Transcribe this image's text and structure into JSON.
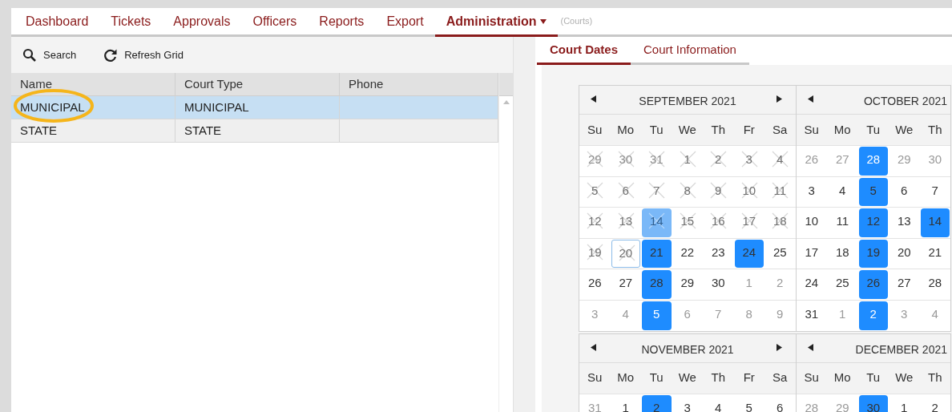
{
  "nav": {
    "tabs": [
      {
        "label": "Dashboard",
        "selected": false,
        "menu": false
      },
      {
        "label": "Tickets",
        "selected": false,
        "menu": false
      },
      {
        "label": "Approvals",
        "selected": false,
        "menu": false
      },
      {
        "label": "Officers",
        "selected": false,
        "menu": false
      },
      {
        "label": "Reports",
        "selected": false,
        "menu": false
      },
      {
        "label": "Export",
        "selected": false,
        "menu": false
      },
      {
        "label": "Administration",
        "selected": true,
        "menu": true
      }
    ],
    "context": "(Courts)"
  },
  "toolbar": [
    {
      "kind": "search",
      "label": "Search"
    },
    {
      "kind": "refresh",
      "label": "Refresh Grid"
    }
  ],
  "grid": {
    "columns": [
      "Name",
      "Court Type",
      "Phone"
    ],
    "rows": [
      {
        "cells": [
          "MUNICIPAL",
          "MUNICIPAL",
          ""
        ],
        "selected": true,
        "circled": true
      },
      {
        "cells": [
          "STATE",
          "STATE",
          ""
        ],
        "selected": false,
        "circled": false
      }
    ]
  },
  "detail_tabs": [
    {
      "label": "Court Dates",
      "selected": true
    },
    {
      "label": "Court Information",
      "selected": false
    }
  ],
  "calendars": [
    {
      "title": "SEPTEMBER 2021",
      "has_next": true,
      "weekdays": [
        "Su",
        "Mo",
        "Tu",
        "We",
        "Th",
        "Fr",
        "Sa"
      ],
      "weeks": [
        [
          {
            "d": "29",
            "muted": true,
            "crossed": true,
            "marked": false,
            "today": false
          },
          {
            "d": "30",
            "muted": true,
            "crossed": true,
            "marked": false,
            "today": false
          },
          {
            "d": "31",
            "muted": true,
            "crossed": true,
            "marked": false,
            "today": false
          },
          {
            "d": "1",
            "muted": false,
            "crossed": true,
            "marked": false,
            "today": false
          },
          {
            "d": "2",
            "muted": false,
            "crossed": true,
            "marked": false,
            "today": false
          },
          {
            "d": "3",
            "muted": false,
            "crossed": true,
            "marked": false,
            "today": false
          },
          {
            "d": "4",
            "muted": false,
            "crossed": true,
            "marked": false,
            "today": false
          }
        ],
        [
          {
            "d": "5",
            "muted": false,
            "crossed": true,
            "marked": false,
            "today": false
          },
          {
            "d": "6",
            "muted": false,
            "crossed": true,
            "marked": false,
            "today": false
          },
          {
            "d": "7",
            "muted": false,
            "crossed": true,
            "marked": false,
            "today": false
          },
          {
            "d": "8",
            "muted": false,
            "crossed": true,
            "marked": false,
            "today": false
          },
          {
            "d": "9",
            "muted": false,
            "crossed": true,
            "marked": false,
            "today": false
          },
          {
            "d": "10",
            "muted": false,
            "crossed": true,
            "marked": false,
            "today": false
          },
          {
            "d": "11",
            "muted": false,
            "crossed": true,
            "marked": false,
            "today": false
          }
        ],
        [
          {
            "d": "12",
            "muted": false,
            "crossed": true,
            "marked": false,
            "today": false
          },
          {
            "d": "13",
            "muted": false,
            "crossed": true,
            "marked": false,
            "today": false
          },
          {
            "d": "14",
            "muted": false,
            "crossed": true,
            "marked": true,
            "today": false
          },
          {
            "d": "15",
            "muted": false,
            "crossed": true,
            "marked": false,
            "today": false
          },
          {
            "d": "16",
            "muted": false,
            "crossed": true,
            "marked": false,
            "today": false
          },
          {
            "d": "17",
            "muted": false,
            "crossed": true,
            "marked": false,
            "today": false
          },
          {
            "d": "18",
            "muted": false,
            "crossed": true,
            "marked": false,
            "today": false
          }
        ],
        [
          {
            "d": "19",
            "muted": false,
            "crossed": true,
            "marked": false,
            "today": false
          },
          {
            "d": "20",
            "muted": false,
            "crossed": true,
            "marked": false,
            "today": true
          },
          {
            "d": "21",
            "muted": false,
            "crossed": false,
            "marked": true,
            "today": false
          },
          {
            "d": "22",
            "muted": false,
            "crossed": false,
            "marked": false,
            "today": false
          },
          {
            "d": "23",
            "muted": false,
            "crossed": false,
            "marked": false,
            "today": false
          },
          {
            "d": "24",
            "muted": false,
            "crossed": false,
            "marked": true,
            "today": false
          },
          {
            "d": "25",
            "muted": false,
            "crossed": false,
            "marked": false,
            "today": false
          }
        ],
        [
          {
            "d": "26",
            "muted": false,
            "crossed": false,
            "marked": false,
            "today": false
          },
          {
            "d": "27",
            "muted": false,
            "crossed": false,
            "marked": false,
            "today": false
          },
          {
            "d": "28",
            "muted": false,
            "crossed": false,
            "marked": true,
            "today": false
          },
          {
            "d": "29",
            "muted": false,
            "crossed": false,
            "marked": false,
            "today": false
          },
          {
            "d": "30",
            "muted": false,
            "crossed": false,
            "marked": false,
            "today": false
          },
          {
            "d": "1",
            "muted": true,
            "crossed": false,
            "marked": false,
            "today": false
          },
          {
            "d": "2",
            "muted": true,
            "crossed": false,
            "marked": false,
            "today": false
          }
        ],
        [
          {
            "d": "3",
            "muted": true,
            "crossed": false,
            "marked": false,
            "today": false
          },
          {
            "d": "4",
            "muted": true,
            "crossed": false,
            "marked": false,
            "today": false
          },
          {
            "d": "5",
            "muted": true,
            "crossed": false,
            "marked": true,
            "today": false
          },
          {
            "d": "6",
            "muted": true,
            "crossed": false,
            "marked": false,
            "today": false
          },
          {
            "d": "7",
            "muted": true,
            "crossed": false,
            "marked": false,
            "today": false
          },
          {
            "d": "8",
            "muted": true,
            "crossed": false,
            "marked": false,
            "today": false
          },
          {
            "d": "9",
            "muted": true,
            "crossed": false,
            "marked": false,
            "today": false
          }
        ]
      ]
    },
    {
      "title": "OCTOBER 2021",
      "has_next": false,
      "weekdays": [
        "Su",
        "Mo",
        "Tu",
        "We",
        "Th"
      ],
      "weeks": [
        [
          {
            "d": "26",
            "muted": true,
            "crossed": false,
            "marked": false,
            "today": false
          },
          {
            "d": "27",
            "muted": true,
            "crossed": false,
            "marked": false,
            "today": false
          },
          {
            "d": "28",
            "muted": true,
            "crossed": false,
            "marked": true,
            "today": false
          },
          {
            "d": "29",
            "muted": true,
            "crossed": false,
            "marked": false,
            "today": false
          },
          {
            "d": "30",
            "muted": true,
            "crossed": false,
            "marked": false,
            "today": false
          }
        ],
        [
          {
            "d": "3",
            "muted": false,
            "crossed": false,
            "marked": false,
            "today": false
          },
          {
            "d": "4",
            "muted": false,
            "crossed": false,
            "marked": false,
            "today": false
          },
          {
            "d": "5",
            "muted": false,
            "crossed": false,
            "marked": true,
            "today": false
          },
          {
            "d": "6",
            "muted": false,
            "crossed": false,
            "marked": false,
            "today": false
          },
          {
            "d": "7",
            "muted": false,
            "crossed": false,
            "marked": false,
            "today": false
          }
        ],
        [
          {
            "d": "10",
            "muted": false,
            "crossed": false,
            "marked": false,
            "today": false
          },
          {
            "d": "11",
            "muted": false,
            "crossed": false,
            "marked": false,
            "today": false
          },
          {
            "d": "12",
            "muted": false,
            "crossed": false,
            "marked": true,
            "today": false
          },
          {
            "d": "13",
            "muted": false,
            "crossed": false,
            "marked": false,
            "today": false
          },
          {
            "d": "14",
            "muted": false,
            "crossed": false,
            "marked": true,
            "today": false
          }
        ],
        [
          {
            "d": "17",
            "muted": false,
            "crossed": false,
            "marked": false,
            "today": false
          },
          {
            "d": "18",
            "muted": false,
            "crossed": false,
            "marked": false,
            "today": false
          },
          {
            "d": "19",
            "muted": false,
            "crossed": false,
            "marked": true,
            "today": false
          },
          {
            "d": "20",
            "muted": false,
            "crossed": false,
            "marked": false,
            "today": false
          },
          {
            "d": "21",
            "muted": false,
            "crossed": false,
            "marked": false,
            "today": false
          }
        ],
        [
          {
            "d": "24",
            "muted": false,
            "crossed": false,
            "marked": false,
            "today": false
          },
          {
            "d": "25",
            "muted": false,
            "crossed": false,
            "marked": false,
            "today": false
          },
          {
            "d": "26",
            "muted": false,
            "crossed": false,
            "marked": true,
            "today": false
          },
          {
            "d": "27",
            "muted": false,
            "crossed": false,
            "marked": false,
            "today": false
          },
          {
            "d": "28",
            "muted": false,
            "crossed": false,
            "marked": false,
            "today": false
          }
        ],
        [
          {
            "d": "31",
            "muted": false,
            "crossed": false,
            "marked": false,
            "today": false
          },
          {
            "d": "1",
            "muted": true,
            "crossed": false,
            "marked": false,
            "today": false
          },
          {
            "d": "2",
            "muted": true,
            "crossed": false,
            "marked": true,
            "today": false
          },
          {
            "d": "3",
            "muted": true,
            "crossed": false,
            "marked": false,
            "today": false
          },
          {
            "d": "4",
            "muted": true,
            "crossed": false,
            "marked": false,
            "today": false
          }
        ]
      ]
    },
    {
      "title": "NOVEMBER 2021",
      "has_next": true,
      "weekdays": [
        "Su",
        "Mo",
        "Tu",
        "We",
        "Th",
        "Fr",
        "Sa"
      ],
      "weeks": [
        [
          {
            "d": "31",
            "muted": true,
            "crossed": false,
            "marked": false,
            "today": false
          },
          {
            "d": "1",
            "muted": false,
            "crossed": false,
            "marked": false,
            "today": false
          },
          {
            "d": "2",
            "muted": false,
            "crossed": false,
            "marked": true,
            "today": false
          },
          {
            "d": "3",
            "muted": false,
            "crossed": false,
            "marked": false,
            "today": false
          },
          {
            "d": "4",
            "muted": false,
            "crossed": false,
            "marked": false,
            "today": false
          },
          {
            "d": "5",
            "muted": false,
            "crossed": false,
            "marked": false,
            "today": false
          },
          {
            "d": "6",
            "muted": false,
            "crossed": false,
            "marked": false,
            "today": false
          }
        ]
      ]
    },
    {
      "title": "DECEMBER 2021",
      "has_next": false,
      "weekdays": [
        "Su",
        "Mo",
        "Tu",
        "We",
        "Th"
      ],
      "weeks": [
        [
          {
            "d": "28",
            "muted": true,
            "crossed": false,
            "marked": false,
            "today": false
          },
          {
            "d": "29",
            "muted": true,
            "crossed": false,
            "marked": false,
            "today": false
          },
          {
            "d": "30",
            "muted": false,
            "crossed": false,
            "marked": true,
            "today": false
          },
          {
            "d": "1",
            "muted": false,
            "crossed": false,
            "marked": false,
            "today": false
          },
          {
            "d": "2",
            "muted": false,
            "crossed": false,
            "marked": false,
            "today": false
          }
        ]
      ]
    }
  ]
}
